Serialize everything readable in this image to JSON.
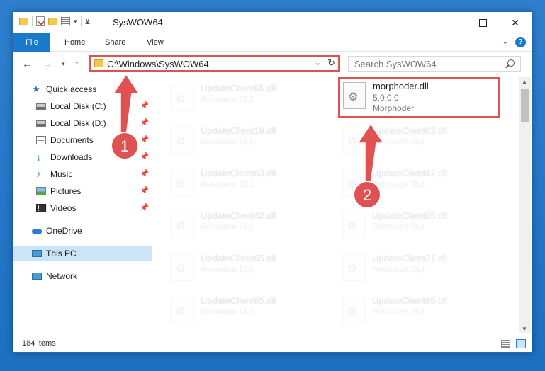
{
  "window": {
    "title": "SysWOW64",
    "minimize_label": "",
    "maximize_label": "",
    "close_label": "✕"
  },
  "ribbon": {
    "tabs": [
      {
        "label": "File"
      },
      {
        "label": "Home"
      },
      {
        "label": "Share"
      },
      {
        "label": "View"
      }
    ],
    "help_label": "?"
  },
  "address_bar": {
    "path": "C:\\Windows\\SysWOW64"
  },
  "search": {
    "placeholder": "Search SysWOW64"
  },
  "sidebar": {
    "items": [
      {
        "label": "Quick access",
        "icon": "star-icon"
      },
      {
        "label": "Local Disk (C:)",
        "icon": "disk-icon",
        "pinned": true
      },
      {
        "label": "Local Disk (D:)",
        "icon": "disk-icon",
        "pinned": true
      },
      {
        "label": "Documents",
        "icon": "documents-icon",
        "pinned": true
      },
      {
        "label": "Downloads",
        "icon": "download-icon",
        "pinned": true
      },
      {
        "label": "Music",
        "icon": "music-icon",
        "pinned": true
      },
      {
        "label": "Pictures",
        "icon": "pictures-icon",
        "pinned": true
      },
      {
        "label": "Videos",
        "icon": "videos-icon",
        "pinned": true
      },
      {
        "label": "OneDrive",
        "icon": "onedrive-icon"
      },
      {
        "label": "This PC",
        "icon": "computer-icon",
        "selected": true
      },
      {
        "label": "Network",
        "icon": "network-icon"
      }
    ]
  },
  "files": {
    "highlighted": {
      "name": "morphoder.dll",
      "version": "5.0.0.0",
      "description": "Morphoder"
    },
    "left_column": [
      {
        "name": "UpdateClient65.dll",
        "type": "Resource DLL"
      },
      {
        "name": "UpdateClient19.dll",
        "type": "Resource DLL"
      },
      {
        "name": "UpdateClient63.dll",
        "type": "Resource DLL"
      },
      {
        "name": "UpdateClient42.dll",
        "type": "Resource DLL"
      },
      {
        "name": "UpdateClient65.dll",
        "type": "Resource DLL"
      },
      {
        "name": "UpdateClient65.dll",
        "type": "Resource DLL"
      }
    ],
    "right_column": [
      {
        "name": "UpdateClient63.dll",
        "type": "Resource DLL"
      },
      {
        "name": "UpdateClient42.dll",
        "type": "Resource DLL"
      },
      {
        "name": "UpdateClient65.dll",
        "type": "Resource DLL"
      },
      {
        "name": "UpdateClient21.dll",
        "type": "Resource DLL"
      },
      {
        "name": "UpdateClient65.dll",
        "type": "Resource DLL"
      }
    ]
  },
  "status": {
    "item_count": "184 items"
  },
  "annotations": {
    "step1": "1",
    "step2": "2",
    "highlight_color": "#e05252"
  }
}
